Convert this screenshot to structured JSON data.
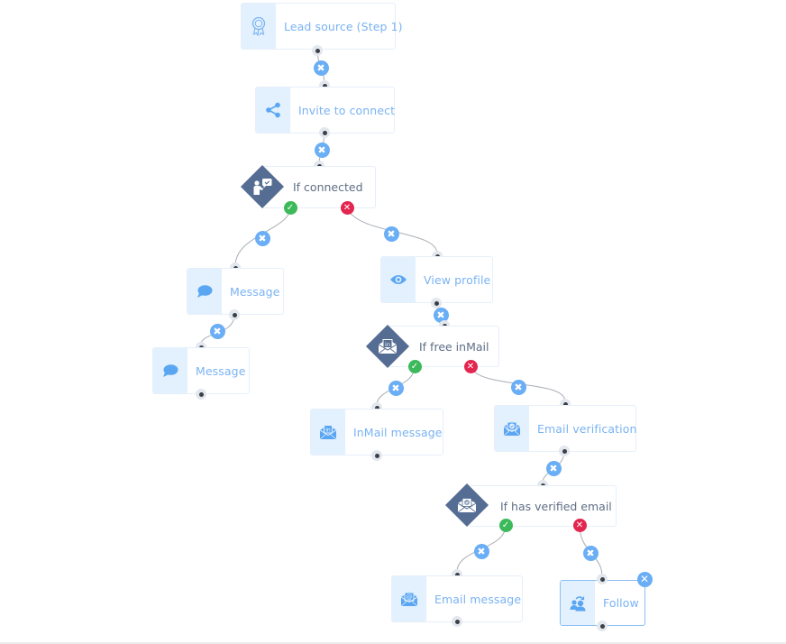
{
  "colors": {
    "accent": "#6aaef5",
    "node_label": "#7ab3f3",
    "icon_panel": "#e3f0fd",
    "condition_diamond": "#566d93",
    "condition_label": "#5f6e86",
    "yes": "#3cb95a",
    "no": "#e3264f"
  },
  "nodes": {
    "lead_source": {
      "label": "Lead source (Step 1)",
      "icon": "award-badge-icon"
    },
    "invite": {
      "label": "Invite to connect",
      "icon": "share-icon"
    },
    "if_connected": {
      "label": "If connected",
      "icon": "person-chat-check-icon"
    },
    "message_1": {
      "label": "Message",
      "icon": "chat-bubble-icon"
    },
    "message_2": {
      "label": "Message",
      "icon": "chat-bubble-icon"
    },
    "view_profile": {
      "label": "View profile",
      "icon": "eye-icon"
    },
    "if_free_inmail": {
      "label": "If free inMail",
      "icon": "linkedin-envelope-icon"
    },
    "inmail_message": {
      "label": "InMail message",
      "icon": "linkedin-envelope-icon"
    },
    "email_verification": {
      "label": "Email verification",
      "icon": "envelope-check-icon"
    },
    "if_verified_email": {
      "label": "If has verified email",
      "icon": "envelope-check-icon"
    },
    "email_message": {
      "label": "Email message",
      "icon": "envelope-at-icon"
    },
    "follow": {
      "label": "Follow",
      "icon": "follow-people-icon",
      "selected": true
    }
  },
  "glyphs": {
    "delete": "✖",
    "yes": "✓",
    "no": "✕",
    "close": "✕"
  }
}
